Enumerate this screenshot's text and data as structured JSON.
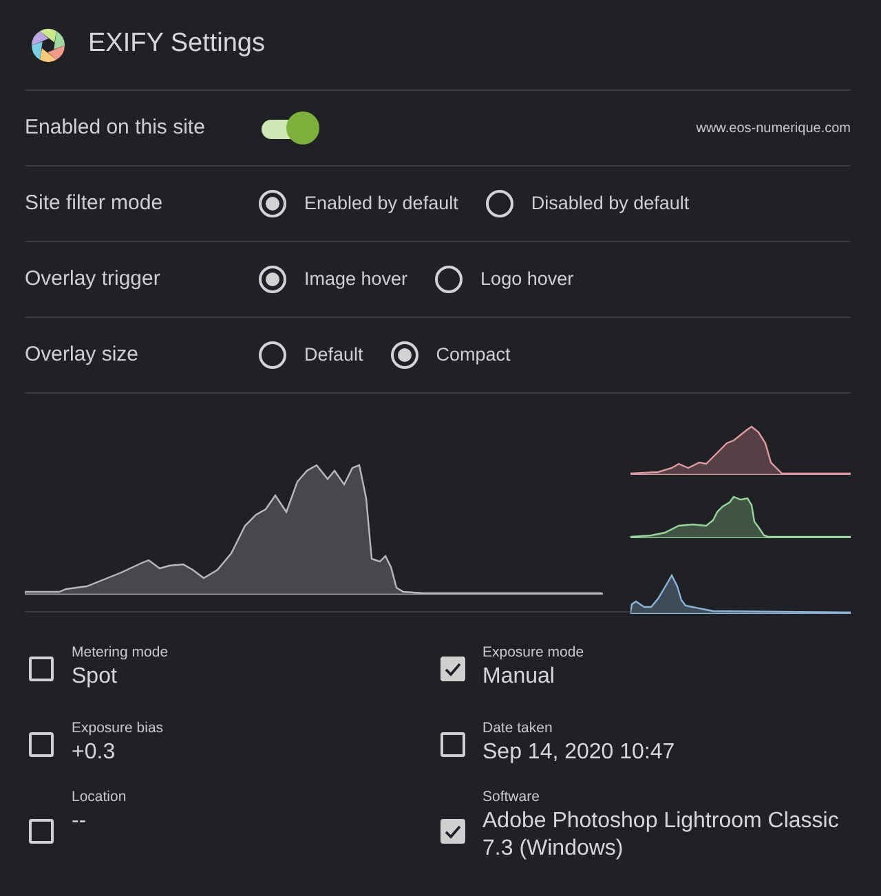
{
  "header": {
    "title": "EXIFY Settings"
  },
  "site_row": {
    "label": "Enabled on this site",
    "on": true,
    "site": "www.eos-numerique.com"
  },
  "radio_rows": [
    {
      "label": "Site filter mode",
      "options": [
        {
          "label": "Enabled by default",
          "selected": true
        },
        {
          "label": "Disabled by default",
          "selected": false
        }
      ]
    },
    {
      "label": "Overlay trigger",
      "options": [
        {
          "label": "Image hover",
          "selected": true
        },
        {
          "label": "Logo hover",
          "selected": false
        }
      ]
    },
    {
      "label": "Overlay size",
      "options": [
        {
          "label": "Default",
          "selected": false
        },
        {
          "label": "Compact",
          "selected": true
        }
      ]
    }
  ],
  "fields": [
    {
      "label": "Metering mode",
      "value": "Spot",
      "checked": false
    },
    {
      "label": "Exposure mode",
      "value": "Manual",
      "checked": true
    },
    {
      "label": "Exposure bias",
      "value": "+0.3",
      "checked": false
    },
    {
      "label": "Date taken",
      "value": "Sep 14, 2020 10:47",
      "checked": false
    },
    {
      "label": "Location",
      "value": "--",
      "checked": false
    },
    {
      "label": "Software",
      "value": "Adobe Photoshop Lightroom Classic 7.3 (Windows)",
      "checked": true
    }
  ]
}
